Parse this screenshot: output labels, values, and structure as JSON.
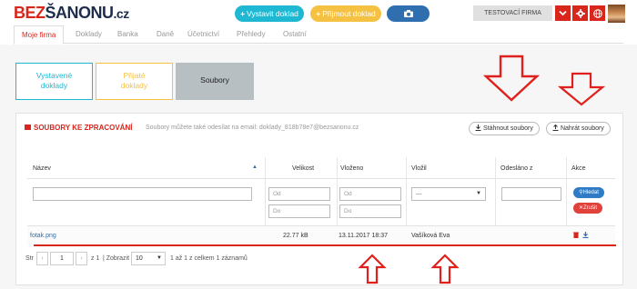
{
  "header": {
    "logo_part1": "BEZ",
    "logo_part2": "ŠANONU",
    "logo_part3": ".cz",
    "issue_button": "Vystavit doklad",
    "receive_button": "Přijmout doklad",
    "camera_icon": "camera-icon",
    "company_name": "TESTOVACÍ FIRMA",
    "icons": [
      "chevron-down-icon",
      "gear-icon",
      "globe-icon"
    ]
  },
  "nav": {
    "tabs": [
      "Moje firma",
      "Doklady",
      "Banka",
      "Daně",
      "Účetnictví",
      "Přehledy",
      "Ostatní"
    ]
  },
  "tiles": {
    "issued_line1": "Vystavené",
    "issued_line2": "doklady",
    "received_line1": "Přijaté",
    "received_line2": "doklady",
    "files": "Soubory"
  },
  "panel": {
    "title": "SOUBORY KE ZPRACOVÁNÍ",
    "subtitle": "Soubory můžete také odesílat na email: doklady_818b78e7@bezsanonu.cz",
    "download_button": "Stáhnout soubory",
    "upload_button": "Nahrát soubory"
  },
  "table": {
    "columns": [
      "Název",
      "Velikost",
      "Vloženo",
      "Vložil",
      "Odesláno z",
      "Akce"
    ],
    "filters": {
      "size_from": "Od",
      "size_to": "Do",
      "date_from": "Od",
      "date_to": "Do",
      "uploader_select": "---",
      "search_button": "Hledat",
      "cancel_button": "Zrušit"
    },
    "rows": [
      {
        "name": "fotak.png",
        "size": "22.77 kB",
        "uploaded": "13.11.2017 18:37",
        "uploader": "Vašíková Eva",
        "sent_from": ""
      }
    ]
  },
  "pagination": {
    "prefix": "Str",
    "page": "1",
    "of_pages": "z 1",
    "show_label": "Zobrazit",
    "per_page": "10",
    "summary": "1 až 1 z celkem 1 záznamů"
  },
  "colors": {
    "brand_red": "#d9261c",
    "issued_cyan": "#1fb8d3",
    "received_yellow": "#f5c142",
    "camera_blue": "#2f6fb0"
  }
}
